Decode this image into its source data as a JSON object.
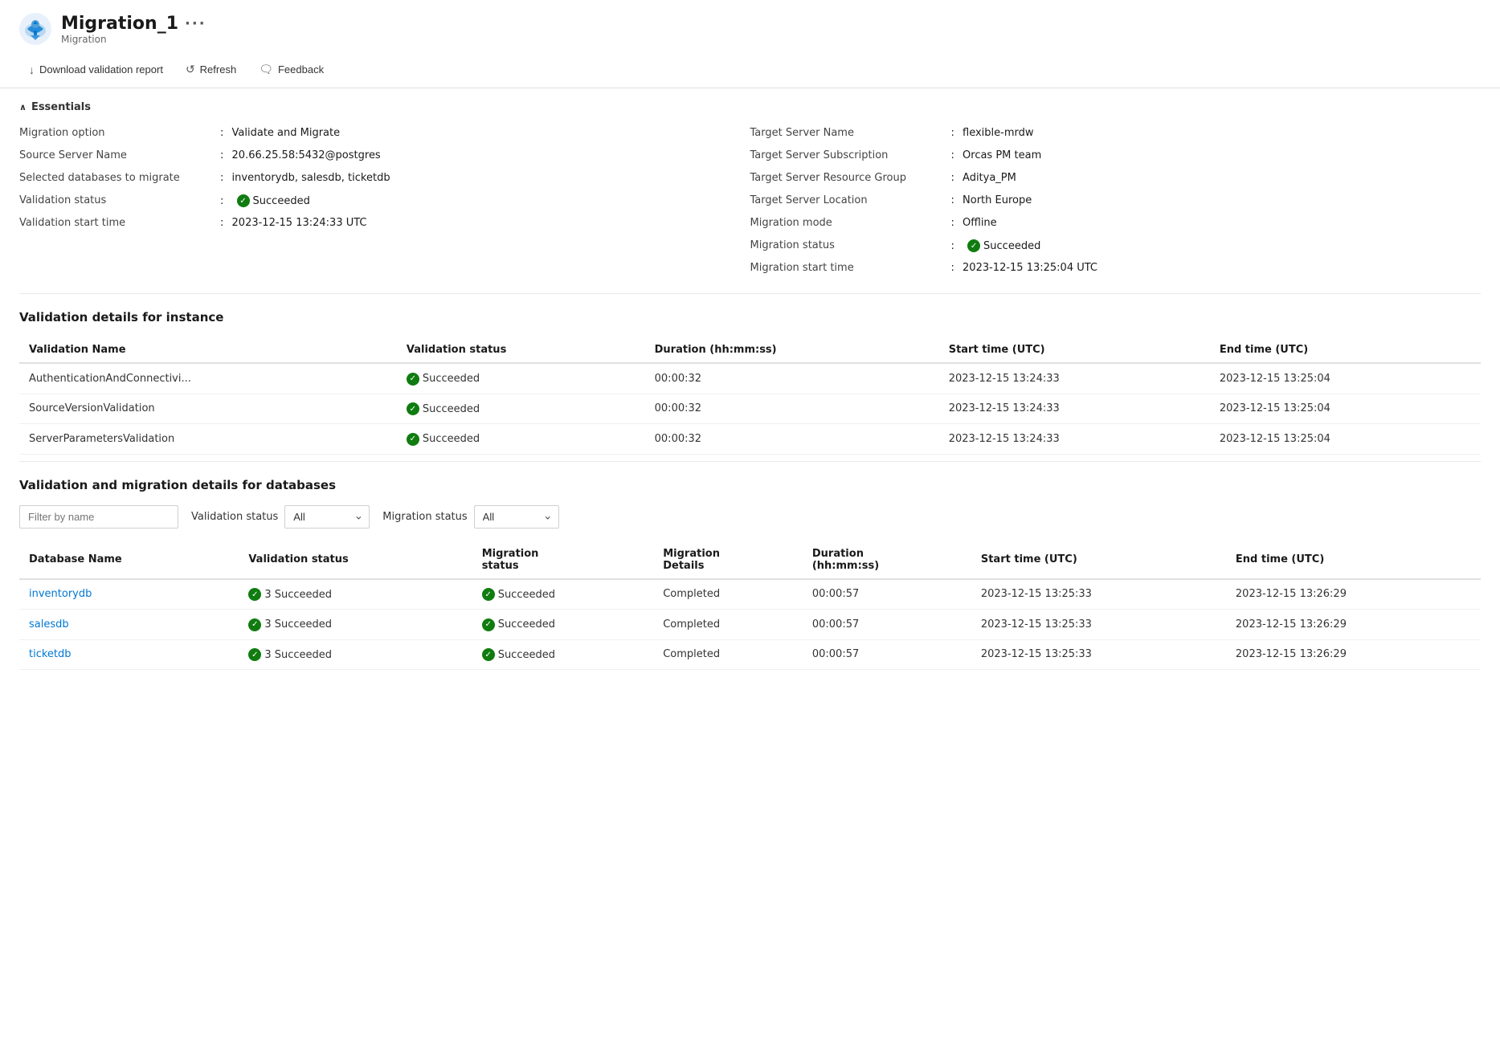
{
  "header": {
    "title": "Migration_1",
    "subtitle": "Migration",
    "more_label": "···"
  },
  "toolbar": {
    "download_label": "Download validation report",
    "refresh_label": "Refresh",
    "feedback_label": "Feedback"
  },
  "essentials": {
    "title": "Essentials",
    "left": [
      {
        "label": "Migration option",
        "value": "Validate and Migrate"
      },
      {
        "label": "Source Server Name",
        "value": "20.66.25.58:5432@postgres"
      },
      {
        "label": "Selected databases to migrate",
        "value": "inventorydb, salesdb, ticketdb"
      },
      {
        "label": "Validation status",
        "value": "Succeeded",
        "badge": true
      },
      {
        "label": "Validation start time",
        "value": "2023-12-15 13:24:33 UTC"
      }
    ],
    "right": [
      {
        "label": "Target Server Name",
        "value": "flexible-mrdw"
      },
      {
        "label": "Target Server Subscription",
        "value": "Orcas PM team"
      },
      {
        "label": "Target Server Resource Group",
        "value": "Aditya_PM"
      },
      {
        "label": "Target Server Location",
        "value": "North Europe"
      },
      {
        "label": "Migration mode",
        "value": "Offline"
      },
      {
        "label": "Migration status",
        "value": "Succeeded",
        "badge": true
      },
      {
        "label": "Migration start time",
        "value": "2023-12-15 13:25:04 UTC"
      }
    ]
  },
  "validation_instance": {
    "title": "Validation details for instance",
    "columns": [
      "Validation Name",
      "Validation status",
      "Duration (hh:mm:ss)",
      "Start time (UTC)",
      "End time (UTC)"
    ],
    "rows": [
      {
        "name": "AuthenticationAndConnectivi...",
        "status": "Succeeded",
        "duration": "00:00:32",
        "start": "2023-12-15 13:24:33",
        "end": "2023-12-15 13:25:04"
      },
      {
        "name": "SourceVersionValidation",
        "status": "Succeeded",
        "duration": "00:00:32",
        "start": "2023-12-15 13:24:33",
        "end": "2023-12-15 13:25:04"
      },
      {
        "name": "ServerParametersValidation",
        "status": "Succeeded",
        "duration": "00:00:32",
        "start": "2023-12-15 13:24:33",
        "end": "2023-12-15 13:25:04"
      }
    ]
  },
  "validation_databases": {
    "title": "Validation and migration details for databases",
    "filter_placeholder": "Filter by name",
    "validation_status_label": "Validation status",
    "migration_status_label": "Migration status",
    "filter_options": [
      "All"
    ],
    "columns": [
      "Database Name",
      "Validation status",
      "Migration status",
      "Migration Details",
      "Duration (hh:mm:ss)",
      "Start time (UTC)",
      "End time (UTC)"
    ],
    "rows": [
      {
        "name": "inventorydb",
        "validation": "3 Succeeded",
        "migration": "Succeeded",
        "details": "Completed",
        "duration": "00:00:57",
        "start": "2023-12-15 13:25:33",
        "end": "2023-12-15 13:26:29"
      },
      {
        "name": "salesdb",
        "validation": "3 Succeeded",
        "migration": "Succeeded",
        "details": "Completed",
        "duration": "00:00:57",
        "start": "2023-12-15 13:25:33",
        "end": "2023-12-15 13:26:29"
      },
      {
        "name": "ticketdb",
        "validation": "3 Succeeded",
        "migration": "Succeeded",
        "details": "Completed",
        "duration": "00:00:57",
        "start": "2023-12-15 13:25:33",
        "end": "2023-12-15 13:26:29"
      }
    ]
  },
  "colors": {
    "success": "#107c10",
    "link": "#0078d4",
    "accent": "#0078d4"
  }
}
